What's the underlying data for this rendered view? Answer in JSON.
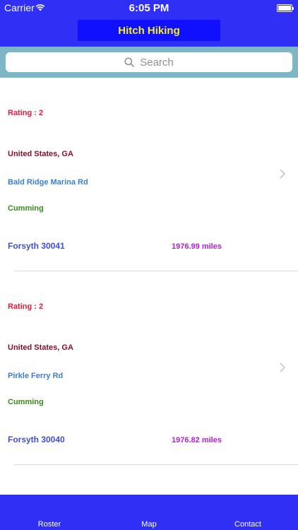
{
  "status_bar": {
    "carrier": "Carrier",
    "time": "6:05 PM"
  },
  "header": {
    "title": "Hitch Hiking",
    "title_color": "#f3ee1e",
    "bar_color": "#2f2ff6"
  },
  "search": {
    "placeholder": "Search"
  },
  "locations": [
    {
      "rating": "Rating : 2",
      "country_state": "United States, GA",
      "street": "Bald Ridge Marina Rd",
      "city": "Cumming",
      "county_zip": "Forsyth  30041",
      "distance": "1976.99 miles"
    },
    {
      "rating": "Rating : 2",
      "country_state": "United States, GA",
      "street": "Pirkle Ferry Rd",
      "city": "Cumming",
      "county_zip": "Forsyth  30040",
      "distance": "1976.82 miles"
    }
  ],
  "tabs": {
    "roster": "Roster",
    "map": "Map",
    "contact": "Contact"
  }
}
